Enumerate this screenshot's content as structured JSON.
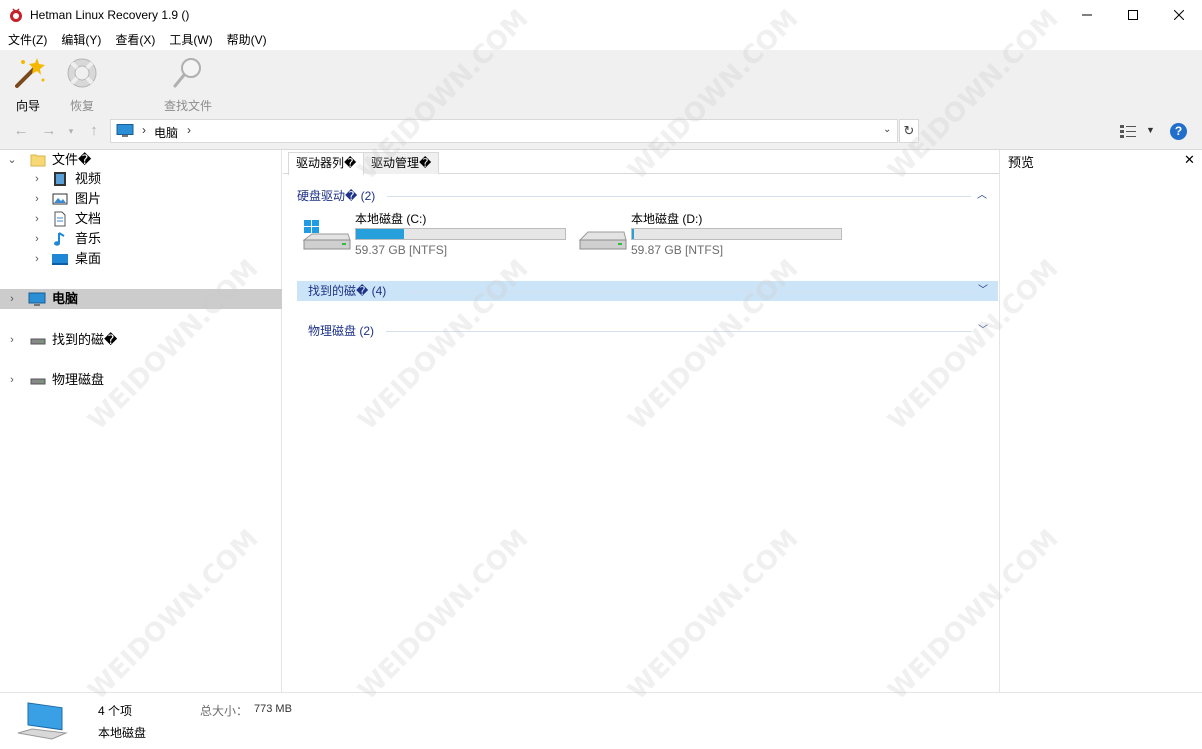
{
  "window": {
    "title": "Hetman Linux Recovery 1.9 ()",
    "min_glyph": "—",
    "max_glyph": "☐",
    "close_glyph": "✕"
  },
  "menu": [
    "文件(Z)",
    "编辑(Y)",
    "查看(X)",
    "工具(W)",
    "帮助(V)"
  ],
  "toolbar": {
    "wizard_label": "向导",
    "recover_label": "恢复",
    "find_label": "查找文件"
  },
  "address": {
    "path": "电脑",
    "separator": "›"
  },
  "tree": {
    "files_label": "文件�",
    "videos": "视频",
    "pictures": "图片",
    "documents": "文档",
    "music": "音乐",
    "desktop": "桌面",
    "computer": "电脑",
    "found_disks": "找到的磁�",
    "physical_disks": "物理磁盘"
  },
  "tabs": {
    "list": "驱动器列�",
    "manage": "驱动管理�"
  },
  "groups": {
    "hard_drives": "硬盘驱动� (2)",
    "found_disks": "找到的磁� (4)",
    "physical_disks": "物理磁盘 (2)"
  },
  "drives": [
    {
      "name": "本地磁盘 (C:)",
      "size": "59.37 GB [NTFS]",
      "used_fraction": 0.23,
      "icon": "windows-drive-icon"
    },
    {
      "name": "本地磁盘 (D:)",
      "size": "59.87 GB [NTFS]",
      "used_fraction": 0.01,
      "icon": "drive-icon"
    }
  ],
  "preview": {
    "title": "预览",
    "close_glyph": "✕"
  },
  "status": {
    "count": "4 个项",
    "type": "本地磁盘",
    "size_label": "总大小：",
    "size_value": "773 MB"
  },
  "watermark": "WEIDOWN.COM",
  "colors": {
    "accent": "#26a0da",
    "group_text": "#1e3287",
    "selected_row": "#cccccc",
    "highlight_row": "#cce4f7"
  }
}
